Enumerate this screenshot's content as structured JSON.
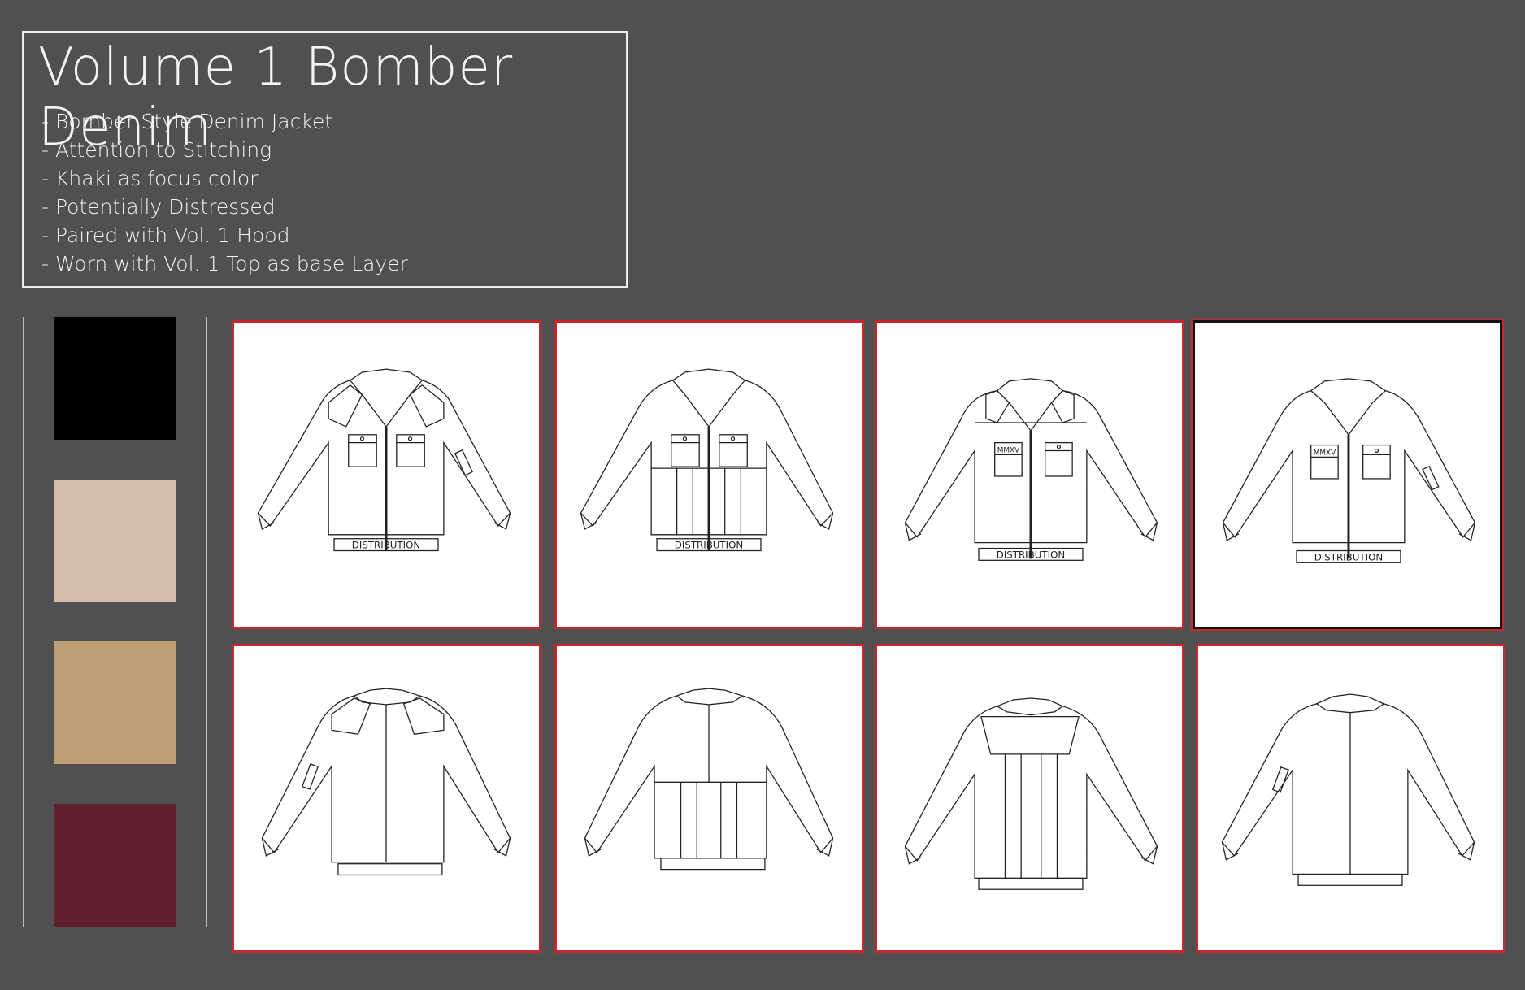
{
  "title": "Volume 1 Bomber Denim",
  "bullets": [
    "- Bomber Style Denim Jacket",
    "- Attention to Stitching",
    "- Khaki as focus color",
    "- Potentially Distressed",
    "- Paired with Vol. 1 Hood",
    "- Worn with Vol. 1 Top as base Layer"
  ],
  "swatches": [
    "#000000",
    "#d4bcad",
    "#bf9e76",
    "#61212c"
  ],
  "accent_border": "#c8262f",
  "labels": {
    "distribution": "DISTRIBUTION",
    "mmxv": "MMXV"
  }
}
